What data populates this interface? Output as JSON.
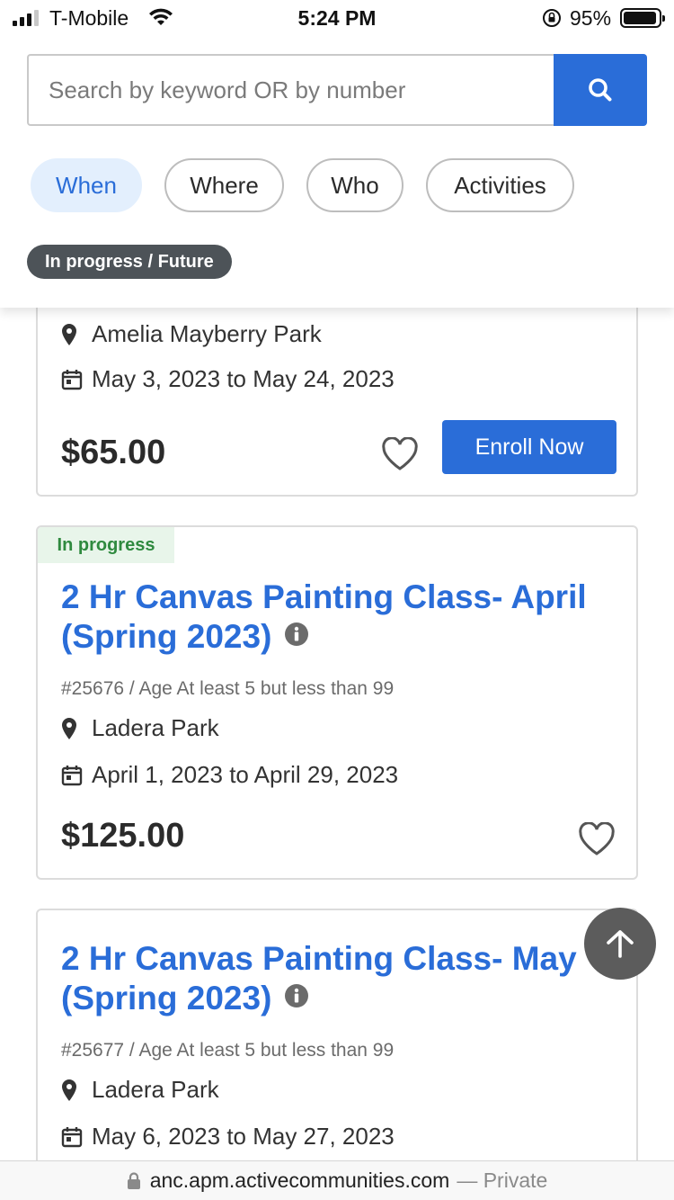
{
  "status_bar": {
    "carrier": "T-Mobile",
    "time": "5:24 PM",
    "battery_percent": "95%",
    "battery_level": 0.95,
    "signal_bars": 3
  },
  "search": {
    "placeholder": "Search by keyword OR by number",
    "button_icon": "search-icon"
  },
  "filters": [
    {
      "label": "When",
      "active": true
    },
    {
      "label": "Where",
      "active": false
    },
    {
      "label": "Who",
      "active": false
    },
    {
      "label": "Activities",
      "active": false
    }
  ],
  "date_chip": "In progress / Future",
  "cards": [
    {
      "location": "Amelia Mayberry Park",
      "dates": "May 3, 2023 to May 24, 2023",
      "price": "$65.00",
      "enroll_label": "Enroll Now"
    },
    {
      "status": "In progress",
      "title_line1": "2 Hr Canvas Painting Class- April",
      "title_line2": "(Spring 2023)",
      "number": "#25676",
      "age": "Age At least 5 but less than 99",
      "location": "Ladera Park",
      "dates": "April 1, 2023 to April 29, 2023",
      "price": "$125.00"
    },
    {
      "title_line1": "2 Hr Canvas Painting Class- May",
      "title_line2": "(Spring 2023)",
      "number": "#25677",
      "age": "Age At least 5 but less than 99",
      "location": "Ladera Park",
      "dates": "May 6, 2023 to May 27, 2023"
    }
  ],
  "meta_separator": "/",
  "url_bar": {
    "domain": "anc.apm.activecommunities.com",
    "private_label": "— Private"
  },
  "colors": {
    "accent": "#2a6dd8",
    "active_filter_bg": "#e3effd",
    "status_green": "#2f8a3f",
    "chip_dark": "#4d5358"
  }
}
